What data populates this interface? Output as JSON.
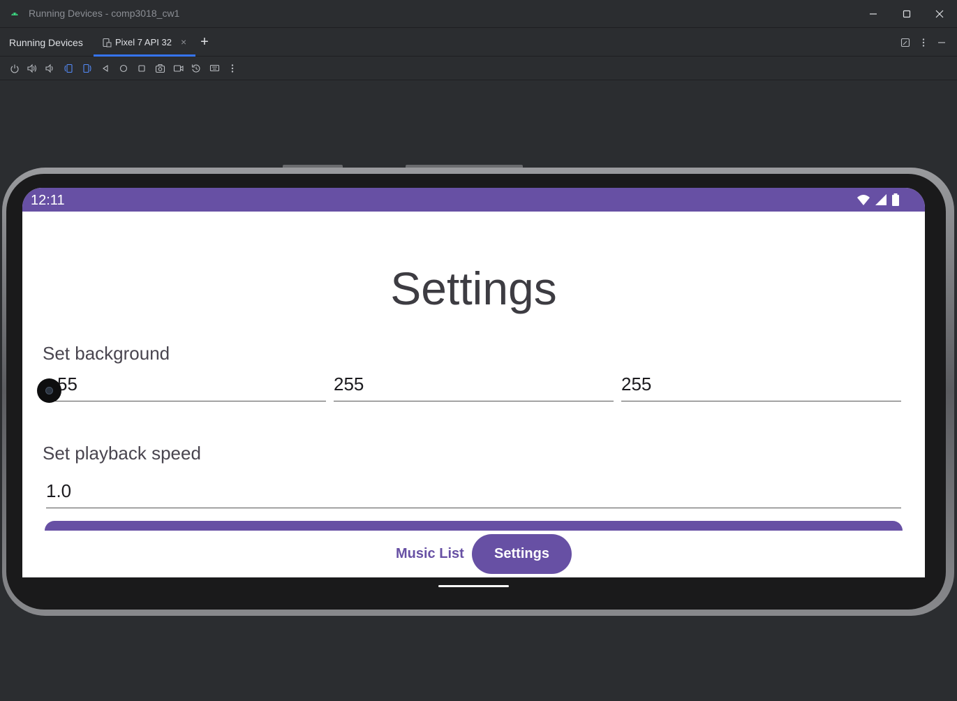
{
  "window": {
    "title": "Running Devices - comp3018_cw1"
  },
  "tool_window": {
    "title": "Running Devices",
    "tabs": [
      {
        "label": "Pixel 7 API 32",
        "active": true
      }
    ]
  },
  "device_toolbar": {
    "icons": [
      "power-icon",
      "volume-up-icon",
      "volume-down-icon",
      "rotate-left-icon",
      "rotate-right-icon",
      "back-icon",
      "home-icon",
      "overview-icon",
      "screenshot-icon",
      "screen-record-icon",
      "reset-icon",
      "keyboard-icon",
      "more-icon"
    ]
  },
  "device": {
    "status_bar": {
      "time": "12:11",
      "color": "#6750a4"
    },
    "screen": {
      "title": "Settings",
      "background_label": "Set background",
      "rgb_values": [
        "255",
        "255",
        "255"
      ],
      "first_value_visible": "55",
      "playback_label": "Set playback speed",
      "playback_value": "1.0"
    },
    "bottom_nav": {
      "music_list": "Music List",
      "settings": "Settings",
      "active": "Settings"
    }
  },
  "colors": {
    "accent": "#6750a4",
    "ide_bg": "#2b2d30",
    "tab_underline": "#3574f0"
  }
}
